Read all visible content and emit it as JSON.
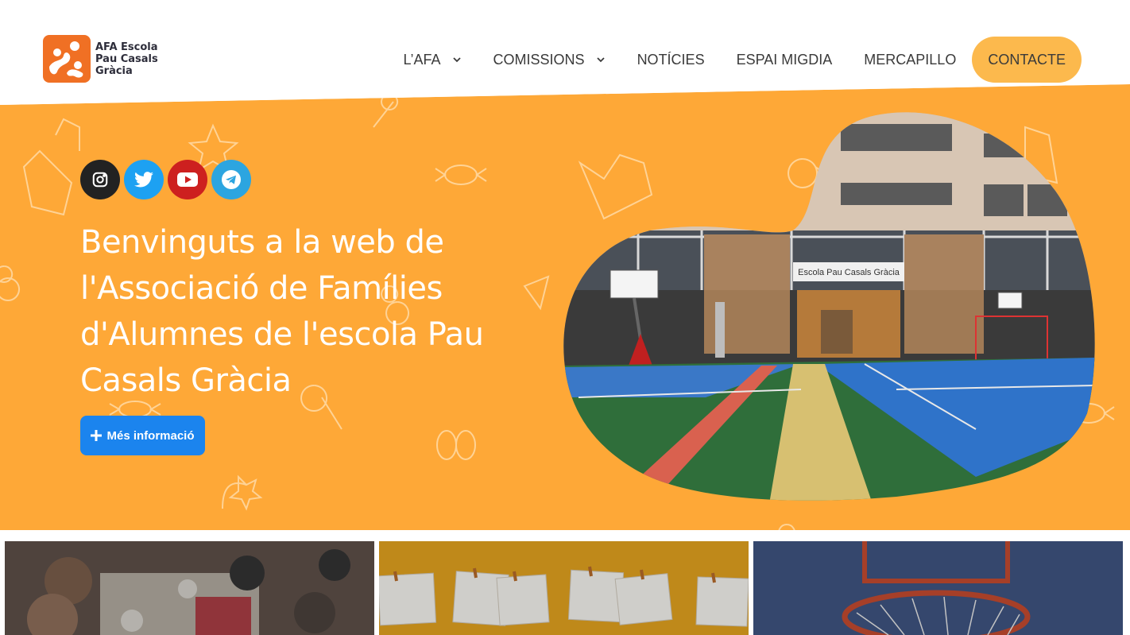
{
  "logo": {
    "line1": "AFA Escola",
    "line2": "Pau Casals",
    "line3": "Gràcia"
  },
  "nav": {
    "items": [
      {
        "label": "L’AFA",
        "has_dropdown": true
      },
      {
        "label": "COMISSIONS",
        "has_dropdown": true
      },
      {
        "label": "NOTÍCIES",
        "has_dropdown": false
      },
      {
        "label": "ESPAI MIGDIA",
        "has_dropdown": false
      },
      {
        "label": "MERCAPILLO",
        "has_dropdown": false
      }
    ],
    "cta": "CONTACTE"
  },
  "hero": {
    "social": [
      {
        "icon": "instagram-icon",
        "color": "#222222"
      },
      {
        "icon": "twitter-icon",
        "color": "#1da1f2"
      },
      {
        "icon": "youtube-icon",
        "color": "#cd201f"
      },
      {
        "icon": "telegram-icon",
        "color": "#2ca5e0"
      }
    ],
    "title": "Benvinguts a la web de l'Associació de Famílies d'Alumnes de l'escola Pau Casals Gràcia",
    "button_label": "Més informació",
    "photo_sign": "Escola Pau Casals Gràcia"
  },
  "colors": {
    "hero_orange": "#fea837",
    "cta_yellow": "#fcb94d",
    "button_blue": "#1b84ee",
    "logo_orange": "#f07024"
  }
}
